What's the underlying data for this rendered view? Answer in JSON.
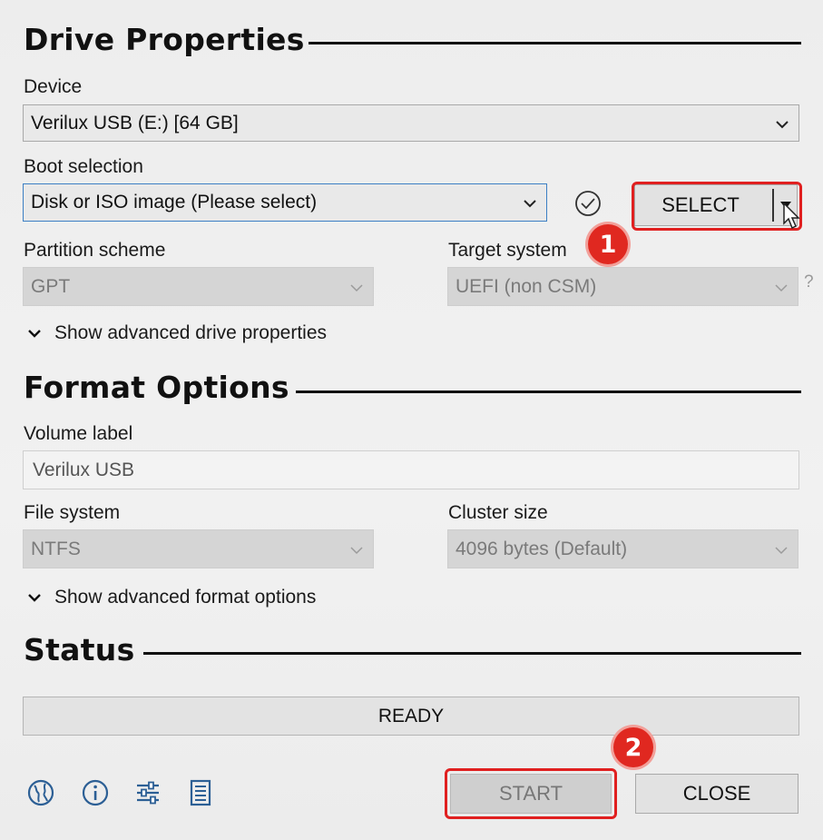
{
  "drive_properties": {
    "title": "Drive Properties",
    "device_label": "Device",
    "device_value": "Verilux USB (E:) [64 GB]",
    "boot_selection_label": "Boot selection",
    "boot_selection_value": "Disk or ISO image (Please select)",
    "select_button": "SELECT",
    "partition_scheme_label": "Partition scheme",
    "partition_scheme_value": "GPT",
    "target_system_label": "Target system",
    "target_system_value": "UEFI (non CSM)",
    "target_help": "?",
    "advanced_toggle": "Show advanced drive properties"
  },
  "format_options": {
    "title": "Format Options",
    "volume_label_label": "Volume label",
    "volume_label_value": "Verilux USB",
    "file_system_label": "File system",
    "file_system_value": "NTFS",
    "cluster_size_label": "Cluster size",
    "cluster_size_value": "4096 bytes (Default)",
    "advanced_toggle": "Show advanced format options"
  },
  "status": {
    "title": "Status",
    "progress_text": "READY"
  },
  "buttons": {
    "start": "START",
    "close": "CLOSE"
  },
  "annotations": {
    "badge_1": "1",
    "badge_2": "2",
    "color": "#e02020"
  },
  "toolbar_icons": [
    "globe-icon",
    "info-icon",
    "settings-sliders-icon",
    "log-icon"
  ]
}
